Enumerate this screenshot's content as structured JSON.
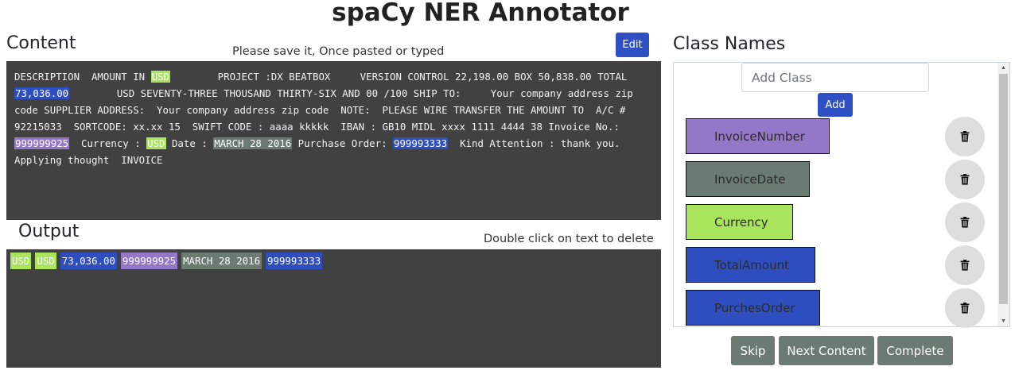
{
  "app": {
    "title": "spaCy NER Annotator"
  },
  "content_section": {
    "heading": "Content",
    "hint": "Please save it, Once pasted or typed",
    "edit_label": "Edit",
    "segments": [
      {
        "text": "DESCRIPTION  AMOUNT IN "
      },
      {
        "text": "USD",
        "label": "Currency"
      },
      {
        "text": "        PROJECT :DX BEATBOX     VERSION CONTROL 22,198.00 BOX 50,838.00 TOTAL "
      },
      {
        "text": "73,036.00",
        "label": "TotalAmount"
      },
      {
        "text": "        USD SEVENTY-THREE THOUSAND THIRTY-SIX AND 00 /100 SHIP TO:     Your company address zip code SUPPLIER ADDRESS:  Your company address zip code  NOTE:  PLEASE WIRE TRANSFER THE AMOUNT TO  A/C # 92215033  SORTCODE: xx.xx 15  SWIFT CODE : aaaa kkkkk  IBAN : GB10 MIDL xxxx 1111 4444 38 Invoice No.: "
      },
      {
        "text": "999999925",
        "label": "InvoiceNumber"
      },
      {
        "text": "  Currency : "
      },
      {
        "text": "USD",
        "label": "Currency"
      },
      {
        "text": " Date : "
      },
      {
        "text": "MARCH 28 2016",
        "label": "InvoiceDate"
      },
      {
        "text": " Purchase Order: "
      },
      {
        "text": "999993333",
        "label": "PurchesOrder"
      },
      {
        "text": "  Kind Attention : thank you. Applying thought  INVOICE"
      }
    ]
  },
  "output_section": {
    "heading": "Output",
    "hint": "Double click on text to delete",
    "entities": [
      {
        "text": "USD",
        "label": "Currency"
      },
      {
        "text": "USD",
        "label": "Currency"
      },
      {
        "text": "73,036.00",
        "label": "TotalAmount"
      },
      {
        "text": "999999925",
        "label": "InvoiceNumber"
      },
      {
        "text": "MARCH 28 2016",
        "label": "InvoiceDate"
      },
      {
        "text": "999993333",
        "label": "PurchesOrder"
      }
    ]
  },
  "class_section": {
    "heading": "Class Names",
    "input_placeholder": "Add Class",
    "add_label": "Add",
    "classes": [
      {
        "name": "InvoiceNumber",
        "color": "#9477c7",
        "delete_icon": "trash-icon"
      },
      {
        "name": "InvoiceDate",
        "color": "#6b7b71",
        "delete_icon": "trash-icon"
      },
      {
        "name": "Currency",
        "color": "#a9e45c",
        "delete_icon": "trash-icon"
      },
      {
        "name": "TotalAmount",
        "color": "#2e4ec0",
        "delete_icon": "trash-icon"
      },
      {
        "name": "PurchesOrder",
        "color": "#2e4ec0",
        "delete_icon": "trash-icon"
      }
    ]
  },
  "actions": {
    "skip_label": "Skip",
    "next_label": "Next Content",
    "complete_label": "Complete"
  },
  "colors": {
    "primary": "#2f4fc4",
    "secondary": "#6b7b71",
    "editor_bg": "#414141"
  }
}
